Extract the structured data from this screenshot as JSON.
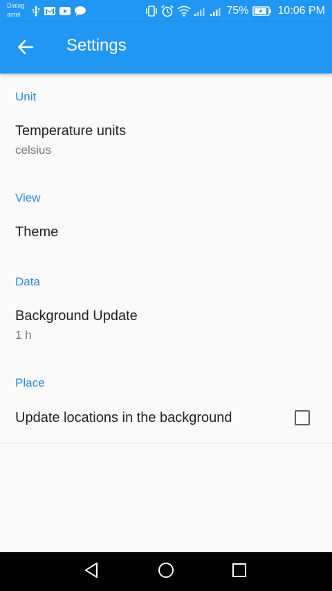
{
  "status_bar": {
    "carrier_1": "Dialog",
    "carrier_2": "airtel",
    "battery_percent": "75%",
    "time": "10:06 PM",
    "icons": [
      "usb-icon",
      "gmail-icon",
      "youtube-icon",
      "chat-icon",
      "vibrate-icon",
      "alarm-icon",
      "wifi-icon",
      "signal-icon",
      "signal-icon",
      "battery-charging-icon"
    ]
  },
  "app_bar": {
    "title": "Settings",
    "back_icon": "arrow-left-icon",
    "color": "#2196f3"
  },
  "sections": [
    {
      "header": "Unit",
      "items": [
        {
          "title": "Temperature units",
          "summary": "celsius"
        }
      ]
    },
    {
      "header": "View",
      "items": [
        {
          "title": "Theme"
        }
      ]
    },
    {
      "header": "Data",
      "items": [
        {
          "title": "Background Update",
          "summary": "1 h"
        }
      ]
    },
    {
      "header": "Place",
      "items": [
        {
          "title": "Update locations in the background",
          "checked": false
        }
      ]
    }
  ],
  "nav_bar": {
    "icons": [
      "back-triangle-icon",
      "home-circle-icon",
      "recents-square-icon"
    ]
  }
}
